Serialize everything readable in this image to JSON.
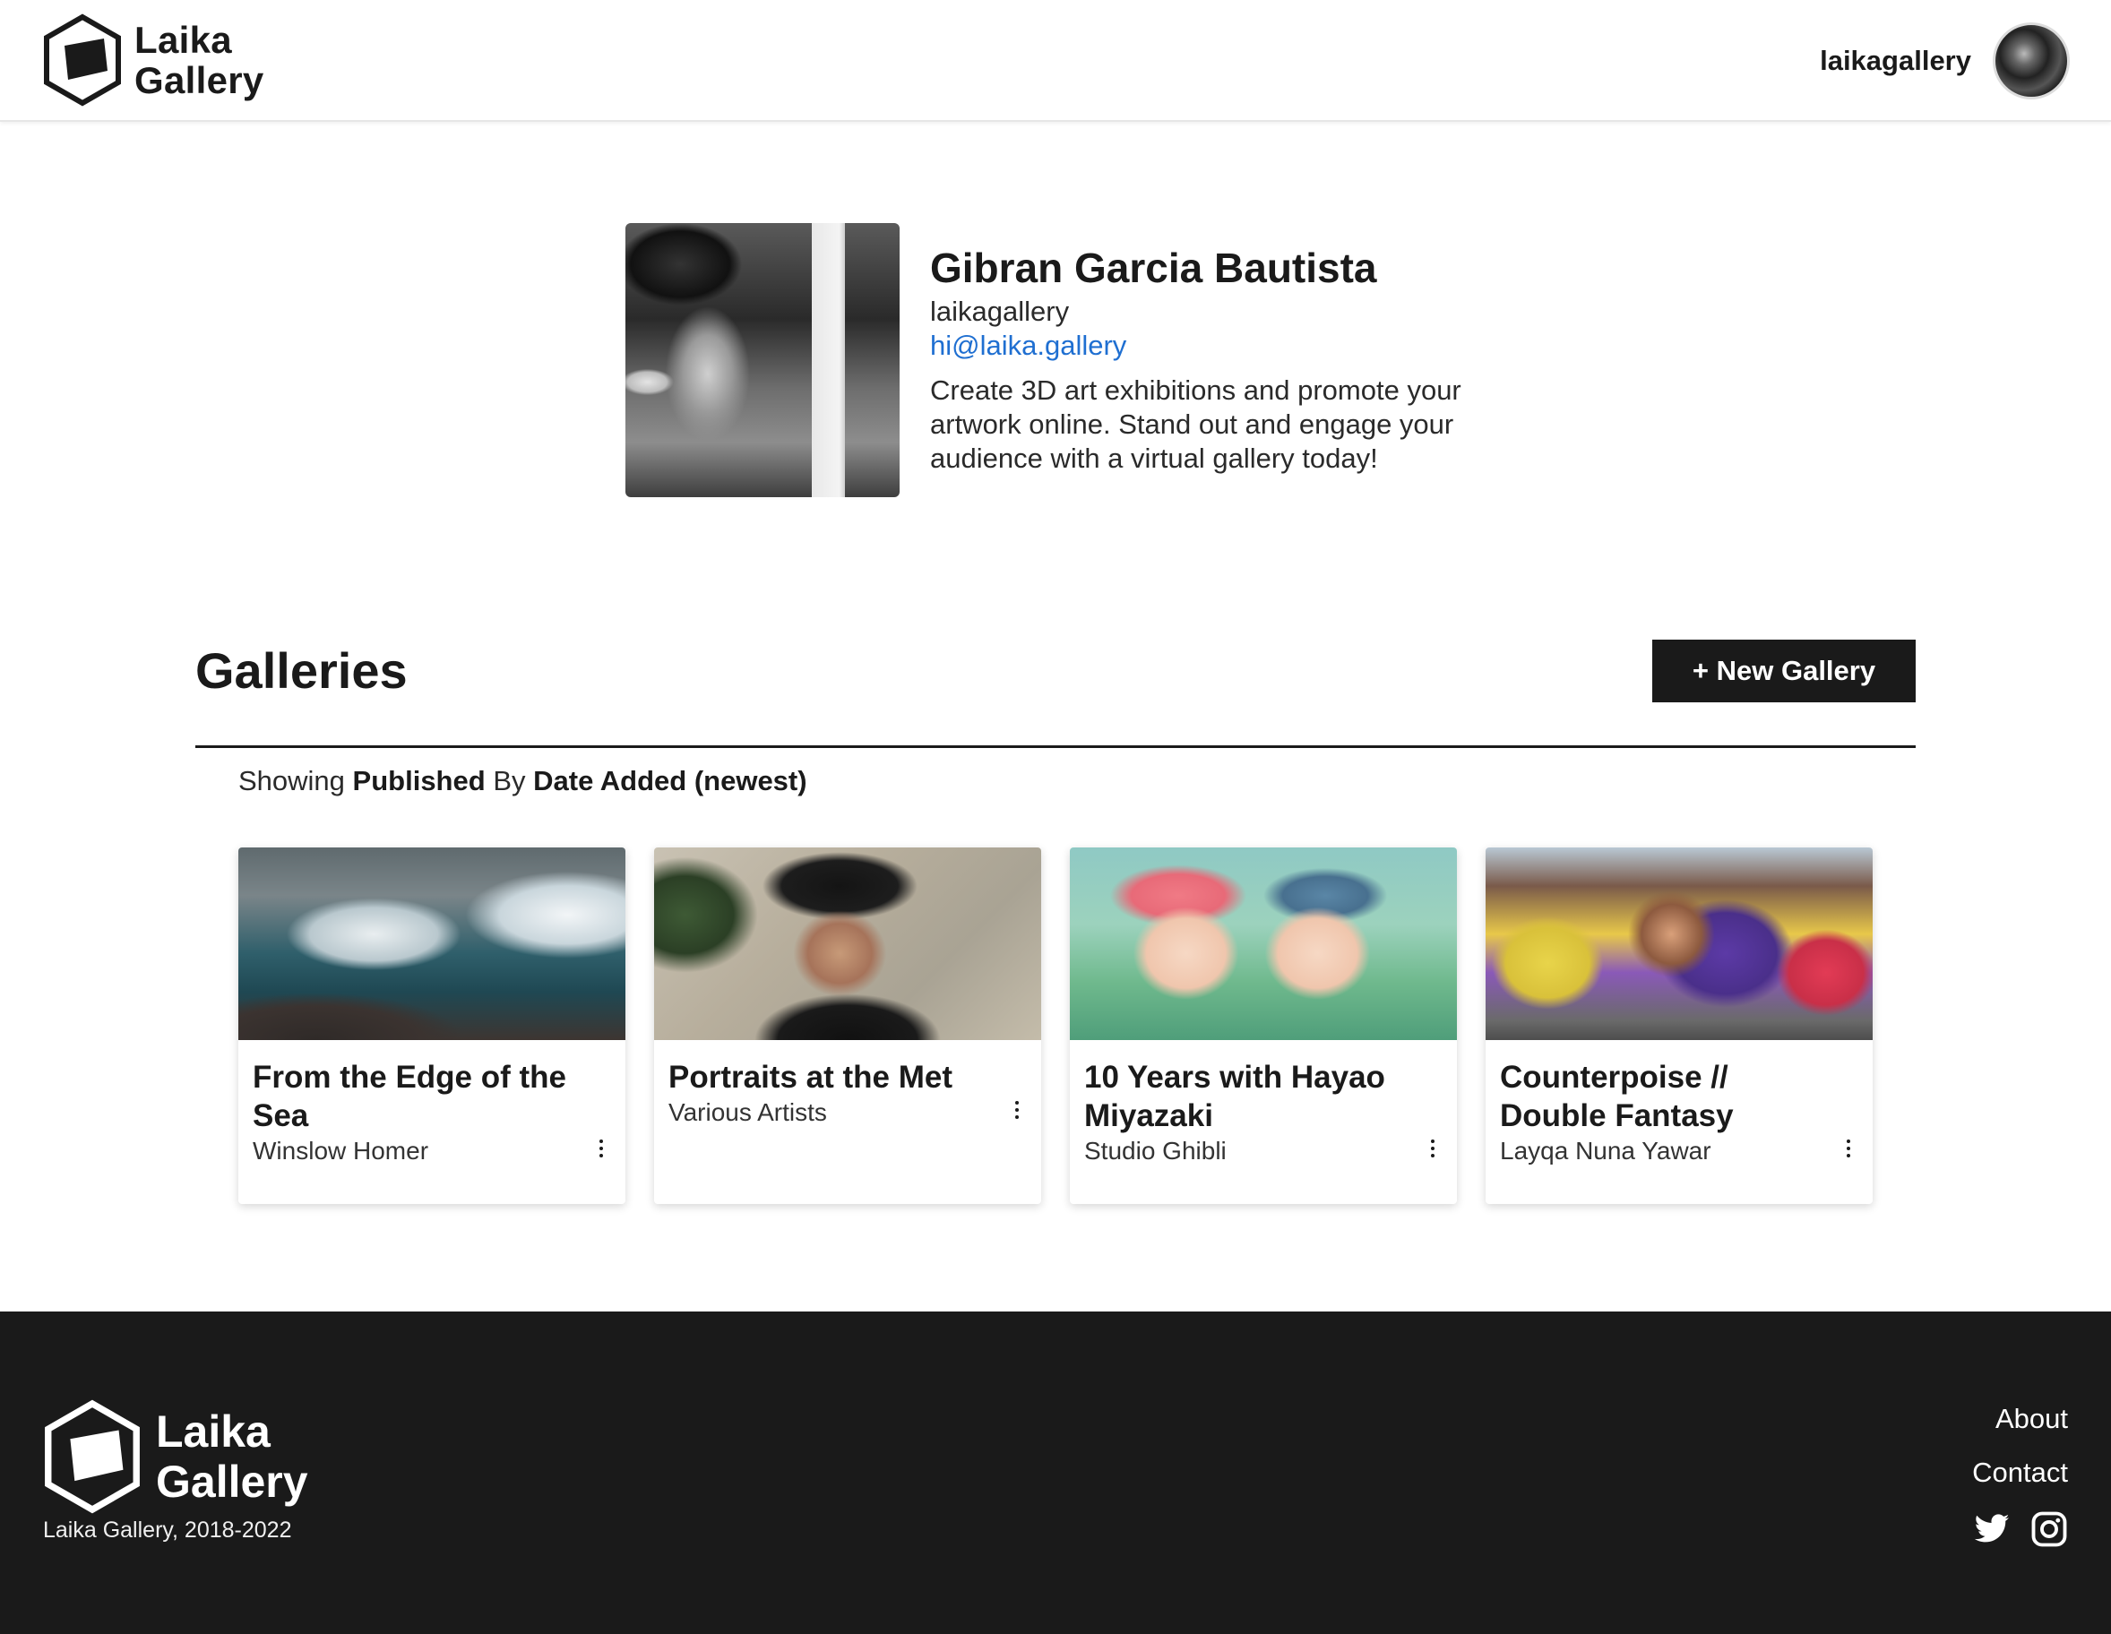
{
  "brand": {
    "line1": "Laika",
    "line2": "Gallery"
  },
  "header": {
    "username": "laikagallery"
  },
  "profile": {
    "name": "Gibran Garcia Bautista",
    "handle": "laikagallery",
    "email": "hi@laika.gallery",
    "bio": "Create 3D art exhibitions and promote your artwork online. Stand out and engage your audience with a virtual gallery today!"
  },
  "galleries": {
    "title": "Galleries",
    "new_button": "+ New Gallery",
    "filter": {
      "prefix": "Showing",
      "status": "Published",
      "by": "By",
      "sort": "Date Added (newest)"
    },
    "cards": [
      {
        "title": "From the Edge of the Sea",
        "subtitle": "Winslow Homer"
      },
      {
        "title": "Portraits at the Met",
        "subtitle": "Various Artists"
      },
      {
        "title": "10 Years with Hayao Miyazaki",
        "subtitle": "Studio Ghibli"
      },
      {
        "title": "Counterpoise // Double Fantasy",
        "subtitle": "Layqa Nuna Yawar"
      }
    ]
  },
  "footer": {
    "copyright": "Laika Gallery, 2018-2022",
    "links": {
      "about": "About",
      "contact": "Contact"
    },
    "social": [
      "twitter-icon",
      "instagram-icon"
    ]
  },
  "colors": {
    "link": "#1f6fd1",
    "dark": "#1a1a1a",
    "footer_bg": "#1a1a1a"
  }
}
